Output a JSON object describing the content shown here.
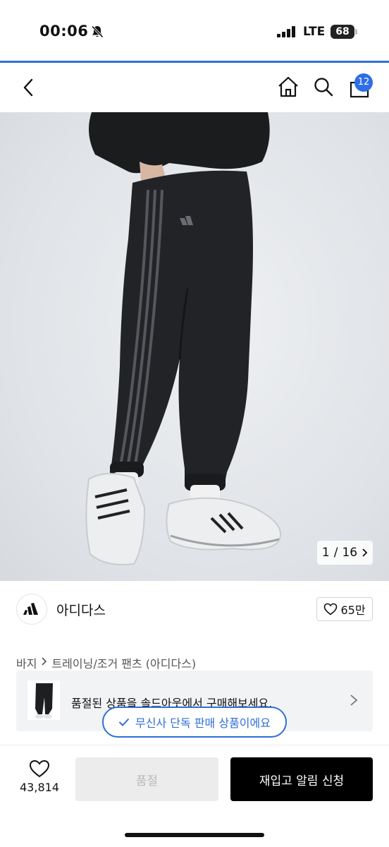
{
  "status_bar": {
    "time": "00:06",
    "network": "LTE",
    "battery": "68"
  },
  "header": {
    "cart_count": "12"
  },
  "gallery": {
    "current": "1",
    "separator": "/",
    "total": "16"
  },
  "brand": {
    "name": "아디다스",
    "like_count": "65만"
  },
  "breadcrumb": {
    "items": [
      "바지",
      "트레이닝/조거 팬츠 (아디다스)"
    ]
  },
  "soldout_banner": {
    "text": "품절된 상품을 솔드아웃에서 구매해보세요."
  },
  "exclusive": {
    "text": "무신사 단독 판매 상품이에요"
  },
  "bottom": {
    "wish_count": "43,814",
    "soldout_label": "품절",
    "restock_label": "재입고 알림 신청"
  },
  "colors": {
    "accent": "#2f6fd6",
    "badge": "#2e6ee8",
    "primary_button": "#000000",
    "disabled_button": "#ececec"
  },
  "icons": [
    "bell-off-icon",
    "signal-icon",
    "back-icon",
    "home-icon",
    "search-icon",
    "shopping-bag-icon",
    "adidas-logo",
    "heart-icon",
    "chevron-right-icon",
    "check-icon"
  ]
}
